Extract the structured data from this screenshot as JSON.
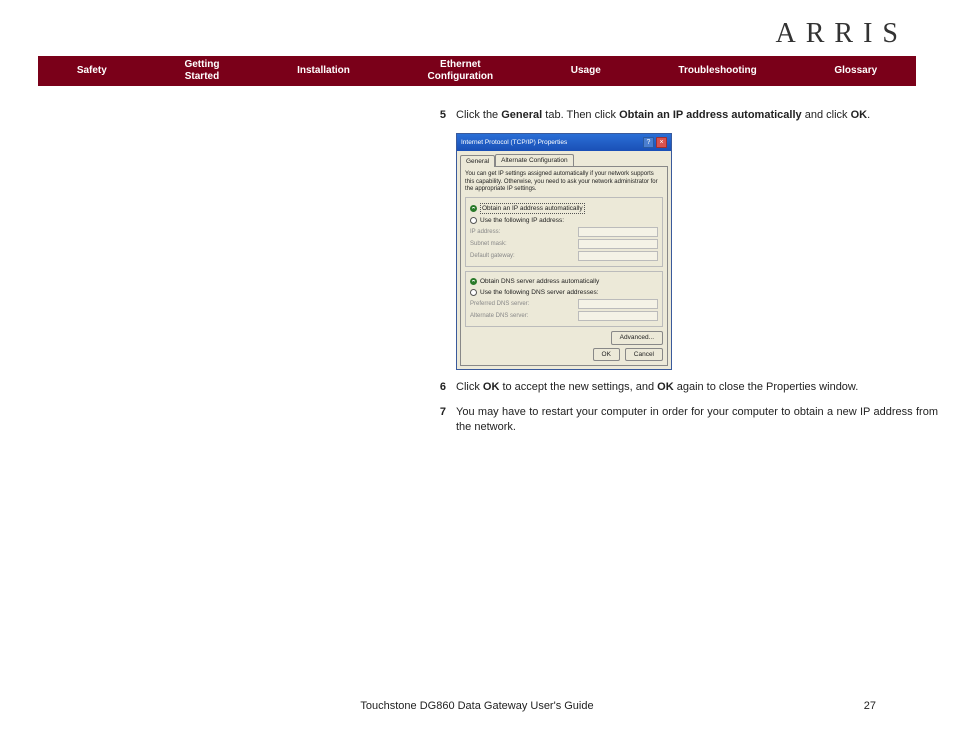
{
  "brand": "ARRIS",
  "nav": {
    "items": [
      {
        "label": "Safety"
      },
      {
        "label": "Getting\nStarted"
      },
      {
        "label": "Installation"
      },
      {
        "label": "Ethernet\nConfiguration"
      },
      {
        "label": "Usage"
      },
      {
        "label": "Troubleshooting"
      },
      {
        "label": "Glossary"
      }
    ]
  },
  "steps": {
    "s5": {
      "num": "5",
      "pre": "Click the ",
      "b1": "General",
      "mid1": " tab. Then click ",
      "b2": "Obtain an IP address automatically",
      "mid2": " and click ",
      "b3": "OK",
      "post": "."
    },
    "s6": {
      "num": "6",
      "pre": "Click ",
      "b1": "OK",
      "mid1": " to accept the new settings, and ",
      "b2": "OK",
      "post": " again to close the Properties window."
    },
    "s7": {
      "num": "7",
      "text": "You may have to restart your computer in order for your computer to obtain a new IP address from the network."
    }
  },
  "dialog": {
    "title": "Internet Protocol (TCP/IP) Properties",
    "tab1": "General",
    "tab2": "Alternate Configuration",
    "info": "You can get IP settings assigned automatically if your network supports this capability. Otherwise, you need to ask your network administrator for the appropriate IP settings.",
    "r1": "Obtain an IP address automatically",
    "r2": "Use the following IP address:",
    "f1": "IP address:",
    "f2": "Subnet mask:",
    "f3": "Default gateway:",
    "r3": "Obtain DNS server address automatically",
    "r4": "Use the following DNS server addresses:",
    "f4": "Preferred DNS server:",
    "f5": "Alternate DNS server:",
    "adv": "Advanced...",
    "ok": "OK",
    "cancel": "Cancel"
  },
  "footer": {
    "title": "Touchstone DG860 Data Gateway User's Guide",
    "page": "27"
  }
}
